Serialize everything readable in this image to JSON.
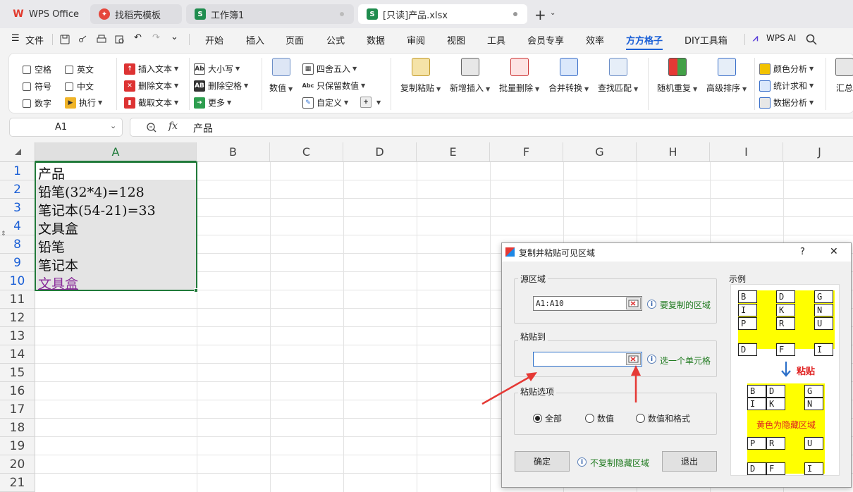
{
  "tabs": [
    {
      "label": "WPS Office",
      "icon": "wps-logo"
    },
    {
      "label": "找稻壳模板",
      "icon": "docer-icon"
    },
    {
      "label": "工作簿1",
      "icon": "sheet-icon"
    },
    {
      "label": "[只读]产品.xlsx",
      "icon": "sheet-icon"
    }
  ],
  "tab_icon_letter": "S",
  "tab_new": "+",
  "menu": {
    "file": "文件",
    "items": [
      "开始",
      "插入",
      "页面",
      "公式",
      "数据",
      "审阅",
      "视图",
      "工具",
      "会员专享",
      "效率",
      "方方格子",
      "DIY工具箱"
    ],
    "selected": "方方格子",
    "wps_ai": "WPS AI"
  },
  "ribbon": {
    "checkboxes": [
      "空格",
      "英文",
      "符号",
      "中文",
      "数字"
    ],
    "exec": "执行",
    "text_tools": [
      "插入文本",
      "删除文本",
      "截取文本"
    ],
    "case_tools": [
      "大小写",
      "删除空格",
      "更多"
    ],
    "value_btn": "数值",
    "num_tools": [
      "四舍五入",
      "只保留数值",
      "自定义"
    ],
    "plus": "+",
    "big_buttons": [
      "复制粘贴",
      "新增插入",
      "批量删除",
      "合并转换",
      "查找匹配",
      "随机重复",
      "高级排序"
    ],
    "analysis": [
      "颜色分析",
      "统计求和",
      "数据分析"
    ],
    "summary": "汇总"
  },
  "namebox": "A1",
  "formula": {
    "fx": "fx",
    "content": "产品"
  },
  "columns": [
    "A",
    "B",
    "C",
    "D",
    "E",
    "F",
    "G",
    "H",
    "I",
    "J"
  ],
  "rows": [
    "1",
    "2",
    "3",
    "4",
    "8",
    "9",
    "10",
    "11",
    "12",
    "13",
    "14",
    "15",
    "16",
    "17",
    "18",
    "19",
    "20",
    "21"
  ],
  "cells": [
    "产品",
    "铅笔(32*4)=128",
    "笔记本(54-21)=33",
    "文具盒",
    "铅笔",
    "笔记本",
    "文具盒"
  ],
  "dialog": {
    "title": "复制并粘贴可见区域",
    "help": "?",
    "close": "✕",
    "source_label": "源区域",
    "source_value": "A1:A10",
    "source_hint": "要复制的区域",
    "paste_label": "粘贴到",
    "paste_value": "",
    "paste_hint": "选一个单元格",
    "options_label": "粘贴选项",
    "options": [
      {
        "label": "全部",
        "checked": true
      },
      {
        "label": "数值",
        "checked": false
      },
      {
        "label": "数值和格式",
        "checked": false
      }
    ],
    "ok": "确定",
    "no_hidden_hint": "不复制隐藏区域",
    "exit": "退出",
    "example_label": "示例",
    "paste_arrow_label": "粘贴",
    "yellow_note": "黄色为隐藏区域",
    "example_top": [
      "B",
      "D",
      "G",
      "I",
      "K",
      "N",
      "P",
      "R",
      "U",
      "D",
      "F",
      "I"
    ],
    "example_bottom": [
      "B",
      "D",
      "G",
      "I",
      "K",
      "N",
      "P",
      "R",
      "U",
      "D",
      "F",
      "I"
    ]
  },
  "colors": {
    "accent": "#1a5fd6",
    "selection": "#217a3a",
    "yellow": "#ffff00",
    "red": "#e02020"
  }
}
